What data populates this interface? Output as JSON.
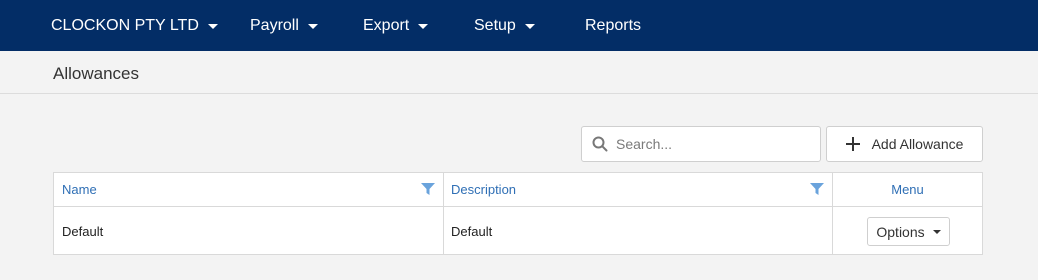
{
  "topnav": {
    "items": [
      {
        "label": "CLOCKON PTY LTD",
        "has_dropdown": true
      },
      {
        "label": "Payroll",
        "has_dropdown": true
      },
      {
        "label": "Export",
        "has_dropdown": true
      },
      {
        "label": "Setup",
        "has_dropdown": true
      },
      {
        "label": "Reports",
        "has_dropdown": false
      }
    ]
  },
  "page": {
    "title": "Allowances"
  },
  "toolbar": {
    "search_placeholder": "Search...",
    "add_label": "Add Allowance"
  },
  "table": {
    "columns": [
      {
        "label": "Name",
        "filterable": true
      },
      {
        "label": "Description",
        "filterable": true
      },
      {
        "label": "Menu",
        "filterable": false
      }
    ],
    "rows": [
      {
        "name": "Default",
        "description": "Default",
        "menu_label": "Options"
      }
    ]
  },
  "colors": {
    "nav_bg": "#032d66",
    "header_text": "#2f6fb5",
    "filter_icon": "#6aa3dc",
    "page_bg": "#f3f3f3"
  }
}
